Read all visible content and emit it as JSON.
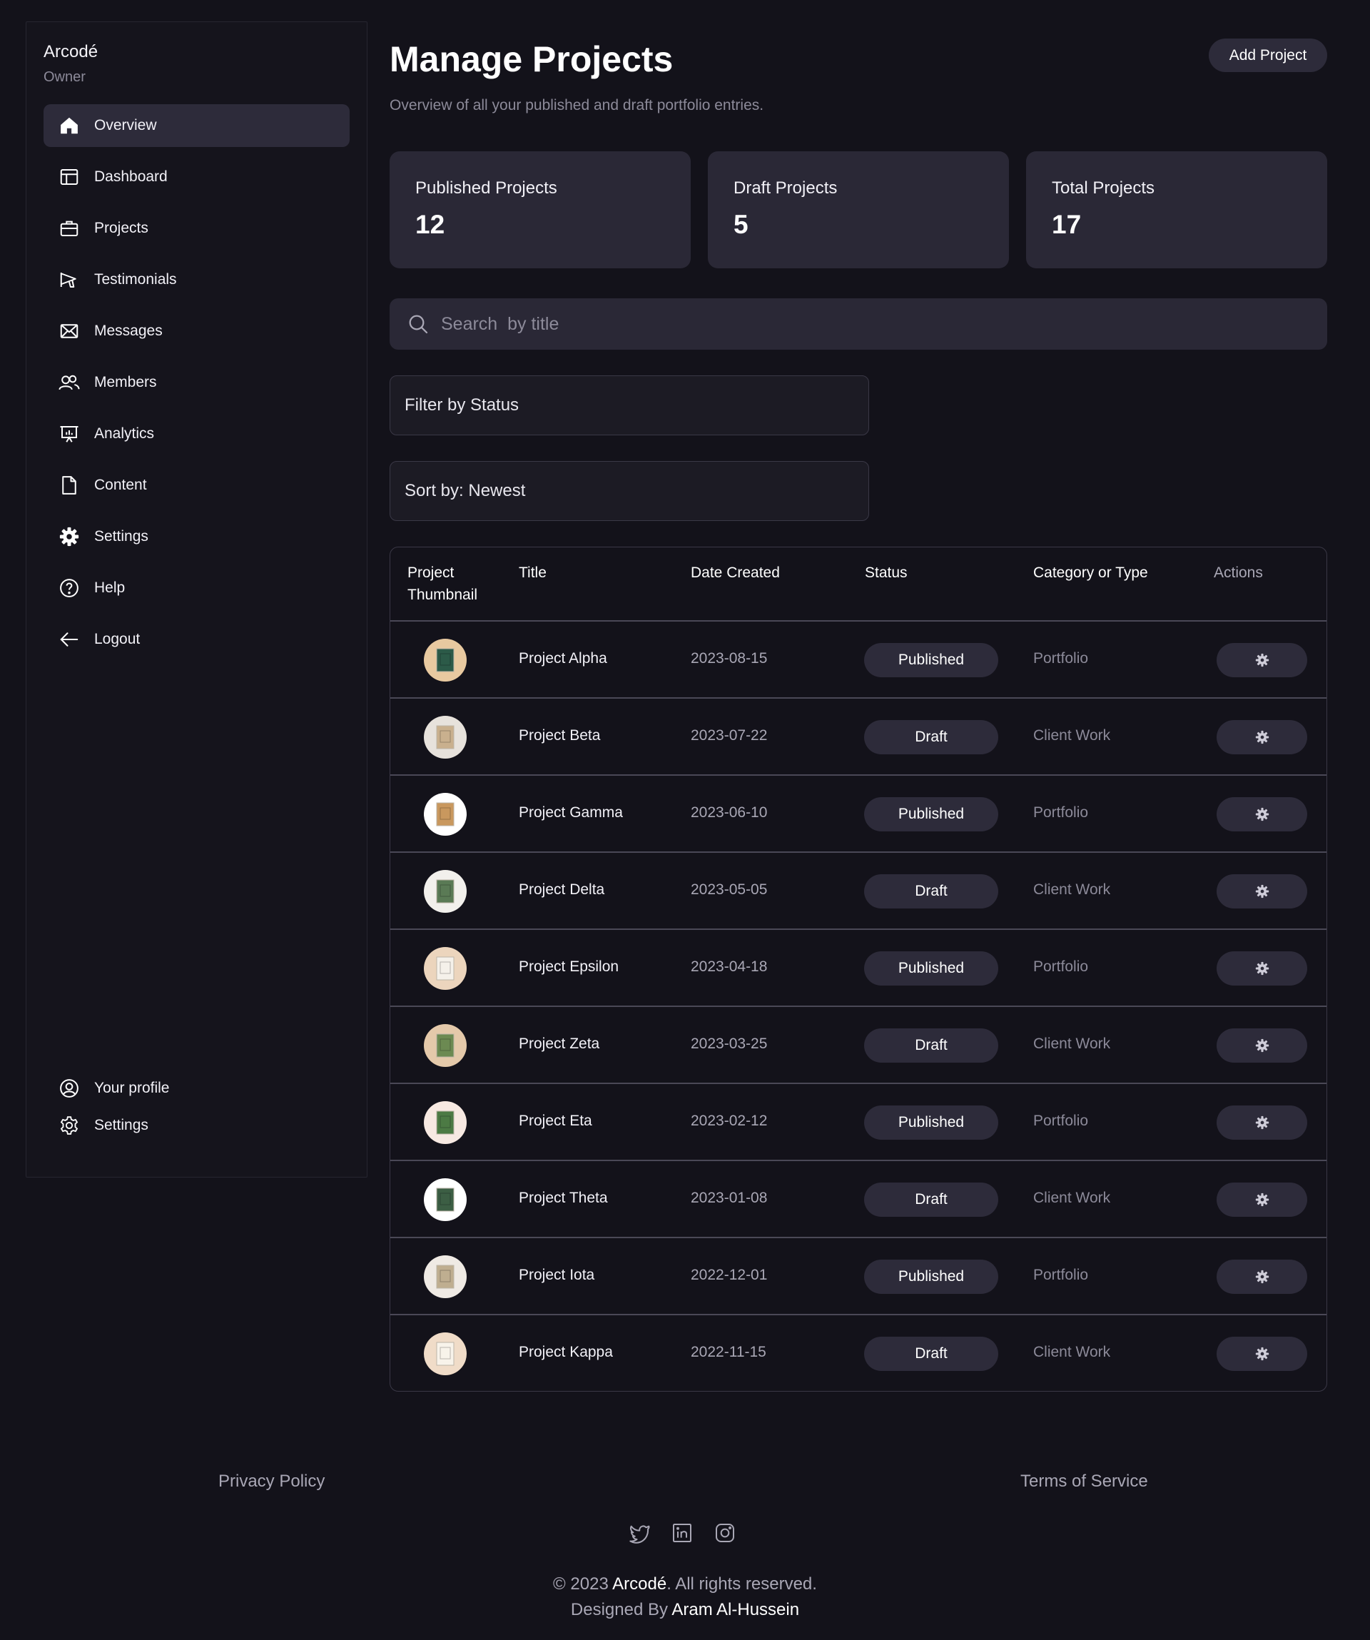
{
  "sidebar": {
    "brand": "Arcodé",
    "role": "Owner",
    "items": [
      {
        "label": "Overview",
        "icon": "home-icon"
      },
      {
        "label": "Dashboard",
        "icon": "layout-icon"
      },
      {
        "label": "Projects",
        "icon": "briefcase-icon"
      },
      {
        "label": "Testimonials",
        "icon": "megaphone-icon"
      },
      {
        "label": "Messages",
        "icon": "mail-icon"
      },
      {
        "label": "Members",
        "icon": "users-icon"
      },
      {
        "label": "Analytics",
        "icon": "presentation-chart-icon"
      },
      {
        "label": "Content",
        "icon": "document-icon"
      },
      {
        "label": "Settings",
        "icon": "gear-icon"
      },
      {
        "label": "Help",
        "icon": "question-icon"
      },
      {
        "label": "Logout",
        "icon": "arrow-left-icon"
      }
    ],
    "bottom": [
      {
        "label": "Your profile",
        "icon": "user-circle-icon"
      },
      {
        "label": "Settings",
        "icon": "gear-outline-icon"
      }
    ]
  },
  "header": {
    "title": "Manage Projects",
    "subtitle": "Overview of all your published and draft portfolio entries.",
    "add_label": "Add Project"
  },
  "stats": [
    {
      "label": "Published Projects",
      "value": "12"
    },
    {
      "label": "Draft Projects",
      "value": "5"
    },
    {
      "label": "Total Projects",
      "value": "17"
    }
  ],
  "search": {
    "placeholder": "Search  by title"
  },
  "filter": {
    "label": "Filter  by  Status"
  },
  "sort": {
    "label": "Sort  by:  Newest"
  },
  "table": {
    "headers": {
      "thumb_line1": "Project",
      "thumb_line2": "Thumbnail",
      "title": "Title",
      "date": "Date Created",
      "status": "Status",
      "category": "Category or Type",
      "actions": "Actions"
    },
    "rows": [
      {
        "title": "Project Alpha",
        "date": "2023-08-15",
        "status": "Published",
        "category": "Portfolio"
      },
      {
        "title": "Project Beta",
        "date": "2023-07-22",
        "status": "Draft",
        "category": "Client Work"
      },
      {
        "title": "Project Gamma",
        "date": "2023-06-10",
        "status": "Published",
        "category": "Portfolio"
      },
      {
        "title": "Project Delta",
        "date": "2023-05-05",
        "status": "Draft",
        "category": "Client Work"
      },
      {
        "title": "Project Epsilon",
        "date": "2023-04-18",
        "status": "Published",
        "category": "Portfolio"
      },
      {
        "title": "Project Zeta",
        "date": "2023-03-25",
        "status": "Draft",
        "category": "Client Work"
      },
      {
        "title": "Project Eta",
        "date": "2023-02-12",
        "status": "Published",
        "category": "Portfolio"
      },
      {
        "title": "Project Theta",
        "date": "2023-01-08",
        "status": "Draft",
        "category": "Client Work"
      },
      {
        "title": "Project Iota",
        "date": "2022-12-01",
        "status": "Published",
        "category": "Portfolio"
      },
      {
        "title": "Project Kappa",
        "date": "2022-11-15",
        "status": "Draft",
        "category": "Client Work"
      }
    ]
  },
  "footer": {
    "privacy": "Privacy Policy",
    "terms": "Terms of Service",
    "copyright_prefix": "© 2023 ",
    "copyright_brand": "Arcodé",
    "copyright_suffix": ". All rights reserved.",
    "designed_prefix": "Designed By ",
    "designed_name": "Aram Al-Hussein",
    "socials": [
      "twitter-icon",
      "linkedin-icon",
      "instagram-icon"
    ]
  },
  "colors": {
    "background": "#13121a",
    "card": "#2a2836",
    "pill": "#2d2b3a",
    "muted_text": "#8c8a99"
  }
}
